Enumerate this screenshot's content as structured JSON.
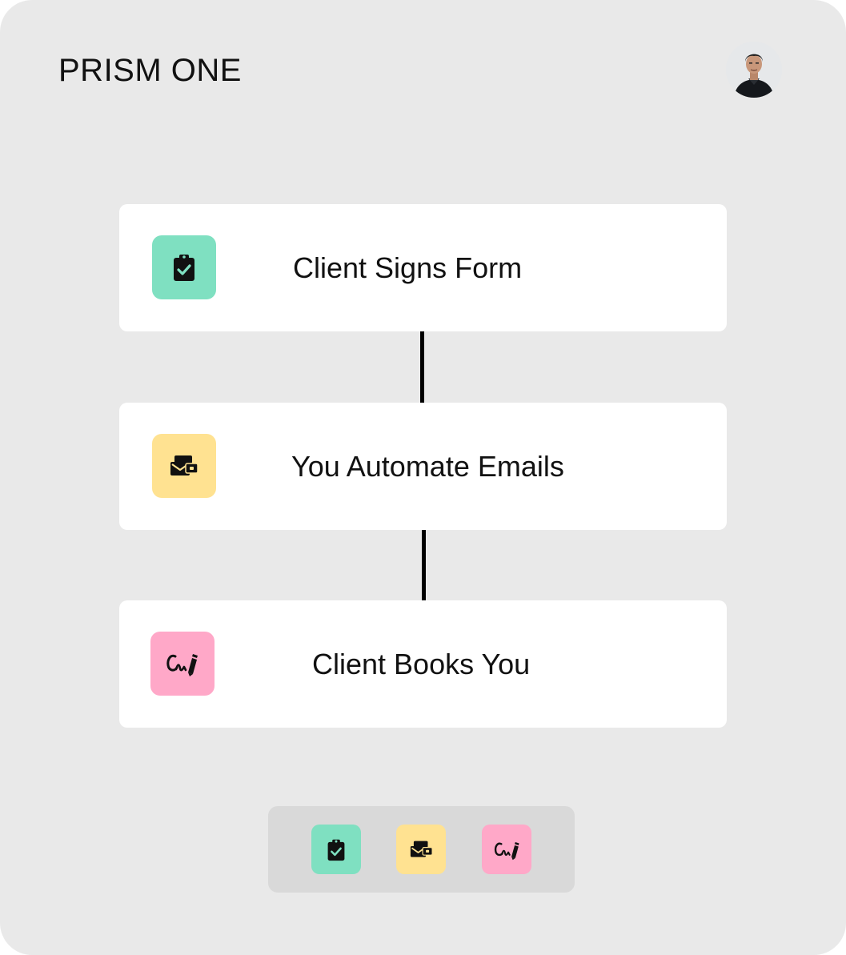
{
  "header": {
    "brand": "PRISM ONE",
    "avatar_icon": "user-avatar-icon"
  },
  "steps": [
    {
      "label": "Client Signs Form",
      "icon": "clipboard-check-icon",
      "color": "#7fe0c1"
    },
    {
      "label": "You Automate Emails",
      "icon": "mail-stack-icon",
      "color": "#ffe291"
    },
    {
      "label": "Client Books You",
      "icon": "signature-pen-icon",
      "color": "#ffa8c8"
    }
  ],
  "dock": {
    "items": [
      {
        "icon": "clipboard-check-icon",
        "color": "#7fe0c1"
      },
      {
        "icon": "mail-stack-icon",
        "color": "#ffe291"
      },
      {
        "icon": "signature-pen-icon",
        "color": "#ffa8c8"
      }
    ]
  }
}
